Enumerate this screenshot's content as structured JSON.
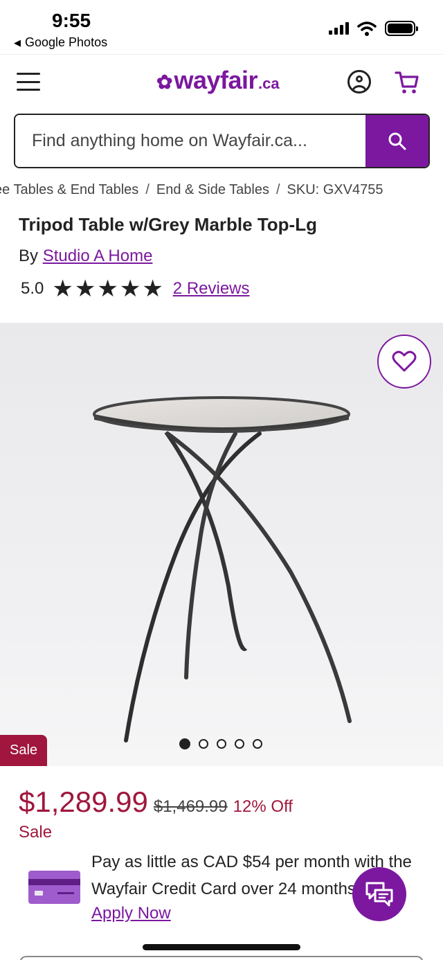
{
  "status_bar": {
    "time": "9:55",
    "back_app": "Google Photos"
  },
  "header": {
    "logo_word": "wayfair",
    "logo_tld": ".ca",
    "brand_color": "#7b189f",
    "icons": [
      "menu-icon",
      "account-icon",
      "cart-icon"
    ]
  },
  "search": {
    "placeholder": "Find anything home on Wayfair.ca..."
  },
  "breadcrumb": [
    "ee Tables & End Tables",
    "End & Side Tables",
    "SKU: GXV4755"
  ],
  "product": {
    "title": "Tripod Table w/Grey Marble Top-Lg",
    "by_label": "By",
    "brand": "Studio A Home",
    "rating": "5.0",
    "stars": 5,
    "reviews_link": "2 Reviews",
    "image_count": 5,
    "active_image": 1,
    "sale_badge": "Sale"
  },
  "pricing": {
    "price": "$1,289.99",
    "old_price": "$1,469.99",
    "discount": "12% Off",
    "sale_label": "Sale",
    "sale_color": "#a0163c"
  },
  "credit": {
    "text": "Pay as little as CAD $54 per month with the Wayfair Credit Card over 24 months.",
    "apply_link": "Apply Now"
  }
}
